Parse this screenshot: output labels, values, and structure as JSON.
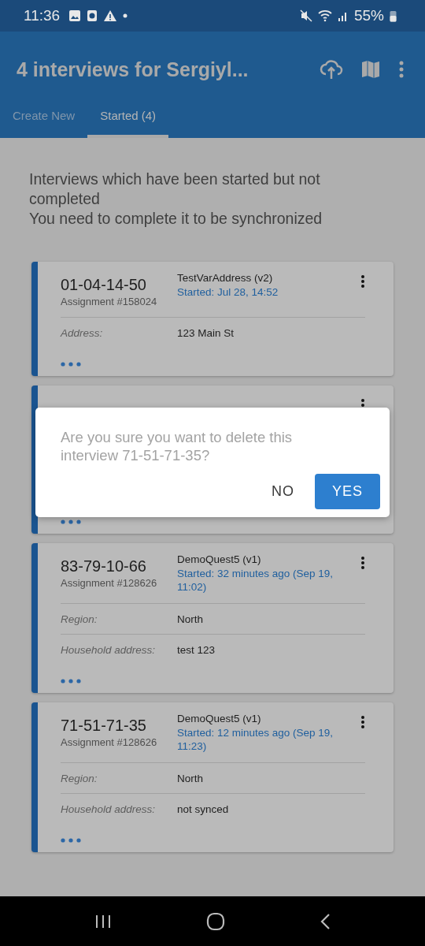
{
  "status_bar": {
    "time": "11:36",
    "battery": "55%"
  },
  "app_bar": {
    "title": "4 interviews for Sergiyl...",
    "tabs": [
      {
        "label": "Create New",
        "selected": false
      },
      {
        "label": "Started (4)",
        "selected": true
      }
    ]
  },
  "intro": {
    "lines": [
      "Interviews which have been started but not completed",
      "You need to complete it to be synchronized"
    ]
  },
  "cards": [
    {
      "kind": "full",
      "id": "01-04-14-50",
      "assignment": "Assignment #158024",
      "questionnaire": "TestVarAddress (v2)",
      "started": "Started: Jul 28, 14:52",
      "fields": [
        {
          "label": "Address:",
          "value": "123 Main St"
        }
      ]
    },
    {
      "kind": "covered"
    },
    {
      "kind": "full",
      "id": "83-79-10-66",
      "assignment": "Assignment #128626",
      "questionnaire": "DemoQuest5 (v1)",
      "started": "Started: 32 minutes ago (Sep 19, 11:02)",
      "fields": [
        {
          "label": "Region:",
          "value": "North"
        },
        {
          "label": "Household address:",
          "value": "test 123"
        }
      ]
    },
    {
      "kind": "full",
      "id": "71-51-71-35",
      "assignment": "Assignment #128626",
      "questionnaire": "DemoQuest5 (v1)",
      "started": "Started: 12 minutes ago (Sep 19, 11:23)",
      "fields": [
        {
          "label": "Region:",
          "value": "North"
        },
        {
          "label": "Household address:",
          "value": "not synced"
        }
      ]
    }
  ],
  "dialog": {
    "message": "Are you sure you want to delete this interview 71-51-71-35?",
    "buttons": [
      {
        "label": "NO",
        "primary": false
      },
      {
        "label": "YES",
        "primary": true
      }
    ]
  }
}
